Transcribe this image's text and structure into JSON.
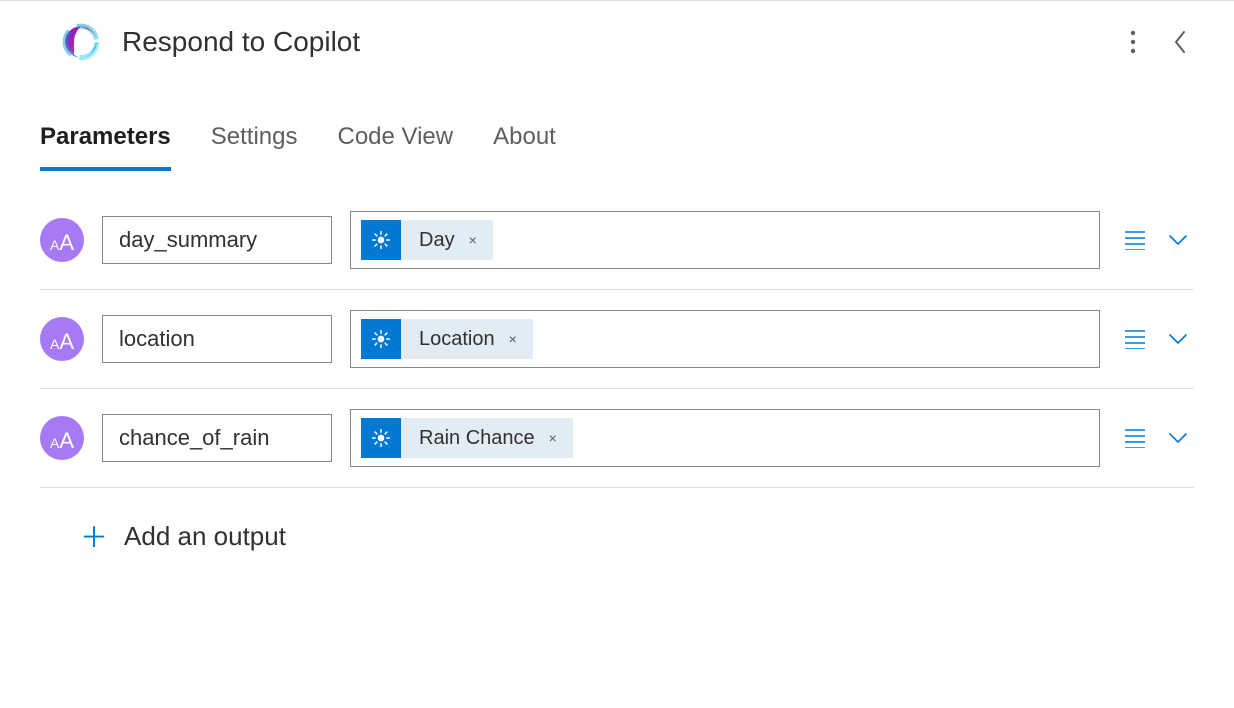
{
  "header": {
    "title": "Respond to Copilot"
  },
  "tabs": [
    {
      "label": "Parameters",
      "active": true
    },
    {
      "label": "Settings",
      "active": false
    },
    {
      "label": "Code View",
      "active": false
    },
    {
      "label": "About",
      "active": false
    }
  ],
  "parameters": [
    {
      "name": "day_summary",
      "token_label": "Day"
    },
    {
      "name": "location",
      "token_label": "Location"
    },
    {
      "name": "chance_of_rain",
      "token_label": "Rain Chance"
    }
  ],
  "add_output_label": "Add an output",
  "token_remove_glyph": "×"
}
